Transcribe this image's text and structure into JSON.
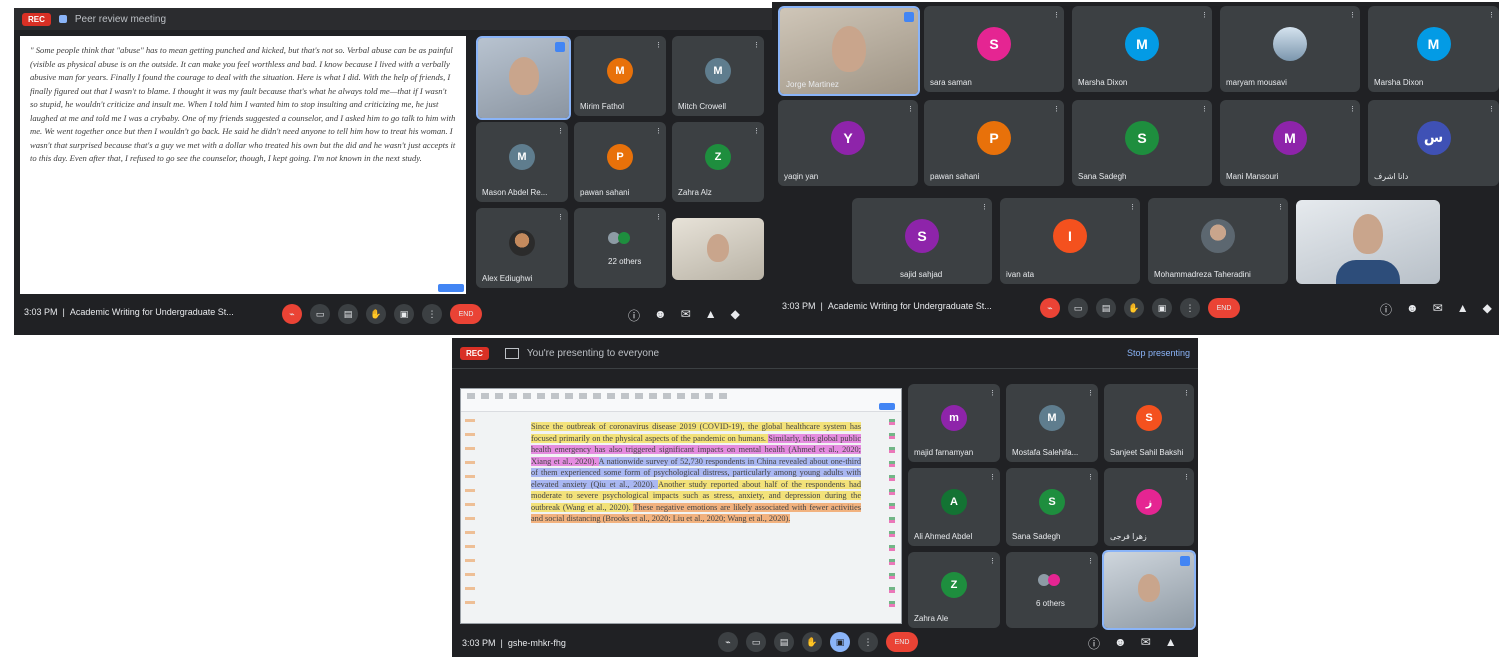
{
  "win1": {
    "rec_label": "REC",
    "meeting_title_top": "Peer review meeting",
    "document_text": "\" Some people think that \"abuse\" has to mean getting punched and kicked, but that's not so. Verbal abuse can be as painful (visible as physical abuse is on the outside. It can make you feel worthless and bad. I know because I lived with a verbally abusive man for years. Finally I found the courage to deal with the situation. Here is what I did. With the help of friends, I finally figured out that I wasn't to blame. I thought it was my fault because that's what he always told me—that if I wasn't so stupid, he wouldn't criticize and insult me. When I told him I wanted him to stop insulting and criticizing me, he just laughed at me and told me I was a crybaby. One of my friends suggested a counselor, and I asked him to go talk to him with me. We went together once but then I wouldn't go back. He said he didn't need anyone to tell him how to treat his woman. I wasn't that surprised because that's a guy we met with a dollar who treated his own but the did and he wasn't just accepts it to this day. Even after that, I refused to go see the counselor, though, I kept going. I'm not known in the next study.",
    "participants": [
      {
        "name": "",
        "initial": "",
        "color": ""
      },
      {
        "name": "Mirim Fathol",
        "initial": "M",
        "color": "#e8710a"
      },
      {
        "name": "Mitch Crowell",
        "initial": "M",
        "color": "#5f7d8e"
      },
      {
        "name": "Mason Abdel Re...",
        "initial": "M",
        "color": "#5f7d8e"
      },
      {
        "name": "pawan sahani",
        "initial": "P",
        "color": "#e8710a"
      },
      {
        "name": "Zahra Alz",
        "initial": "Z",
        "color": "#1e8e3e"
      },
      {
        "name": "Alex Ediughwi",
        "initial": "",
        "color": ""
      },
      {
        "name": "22 others",
        "initial": "",
        "color": ""
      },
      {
        "name": "",
        "initial": "",
        "color": ""
      }
    ],
    "time": "3:03 PM",
    "meeting_name": "Academic Writing for Undergraduate St...",
    "end_label": "END"
  },
  "win2": {
    "participants": [
      {
        "name": "Jorge Martinez",
        "initial": "",
        "color": ""
      },
      {
        "name": "sara saman",
        "initial": "S",
        "color": "#e52592"
      },
      {
        "name": "Marsha Dixon",
        "initial": "M",
        "color": "#039be5"
      },
      {
        "name": "maryam mousavi",
        "initial": "",
        "color": ""
      },
      {
        "name": "Marsha Dixon",
        "initial": "M",
        "color": "#039be5"
      },
      {
        "name": "yaqin yan",
        "initial": "Y",
        "color": "#8e24aa"
      },
      {
        "name": "pawan sahani",
        "initial": "P",
        "color": "#e8710a"
      },
      {
        "name": "Sana Sadegh",
        "initial": "S",
        "color": "#1e8e3e"
      },
      {
        "name": "Mani Mansouri",
        "initial": "M",
        "color": "#8e24aa"
      },
      {
        "name": "دانا اشرف",
        "initial": "س",
        "color": "#3f51b5"
      },
      {
        "name": "sajid sahjad",
        "initial": "S",
        "color": "#8e24aa"
      },
      {
        "name": "ivan ata",
        "initial": "I",
        "color": "#f4511e"
      },
      {
        "name": "Mohammadreza Taheradini",
        "initial": "",
        "color": ""
      },
      {
        "name": "",
        "initial": "",
        "color": ""
      }
    ],
    "time": "3:03 PM",
    "meeting_name": "Academic Writing for Undergraduate St...",
    "end_label": "END"
  },
  "win3": {
    "rec_label": "REC",
    "presenting_label": "You're presenting to everyone",
    "stop_label": "Stop presenting",
    "slide_segments": [
      {
        "t": "Since the outbreak of coronavirus disease 2019 (COVID-19), the global healthcare system has focused primarily on the physical aspects of the pandemic on humans. ",
        "c": "hl-y"
      },
      {
        "t": "Similarly, this global public health emergency has also triggered significant impacts on mental health (Ahmed et al., 2020; Xiang et al., 2020). ",
        "c": "hl-p"
      },
      {
        "t": "A nationwide survey of 52,730 respondents in China revealed about one-third of them experienced some form of psychological distress, particularly among young adults with elevated anxiety (Qiu et al., 2020). ",
        "c": "hl-b"
      },
      {
        "t": "Another study reported about half of the respondents had moderate to severe psychological impacts such as stress, anxiety, and depression during the outbreak (Wang et al., 2020). ",
        "c": "hl-y"
      },
      {
        "t": "These negative emotions are likely associated with fewer activities and social distancing (Brooks et al., 2020; Liu et al., 2020; Wang et al., 2020).",
        "c": "hl-o"
      }
    ],
    "participants": [
      {
        "name": "majid farnamyan",
        "initial": "m",
        "color": "#8e24aa"
      },
      {
        "name": "Mostafa Salehifa...",
        "initial": "M",
        "color": "#5f7d8e"
      },
      {
        "name": "Sanjeet Sahil Bakshi",
        "initial": "S",
        "color": "#f4511e"
      },
      {
        "name": "Ali Ahmed Abdel",
        "initial": "A",
        "color": "#137333"
      },
      {
        "name": "Sana Sadegh",
        "initial": "S",
        "color": "#1e8e3e"
      },
      {
        "name": "زهرا فرجی",
        "initial": "ز",
        "color": "#e52592"
      },
      {
        "name": "Zahra Ale",
        "initial": "Z",
        "color": "#1e8e3e"
      },
      {
        "name": "6 others",
        "initial": "",
        "color": ""
      },
      {
        "name": "",
        "initial": "",
        "color": ""
      }
    ],
    "time": "3:03 PM",
    "meeting_name": "gshe-mhkr-fhg",
    "end_label": "END"
  }
}
